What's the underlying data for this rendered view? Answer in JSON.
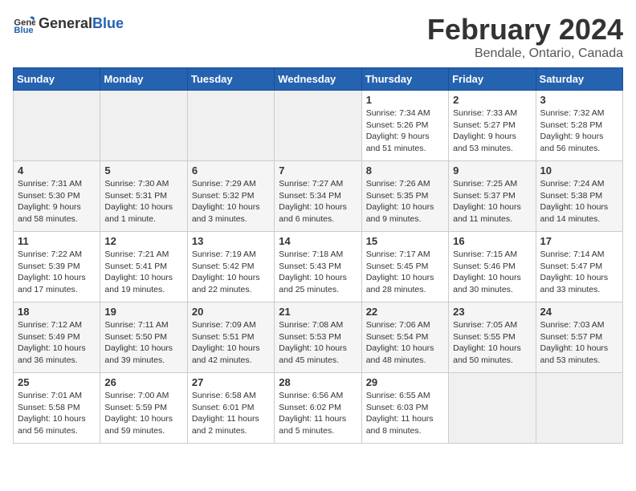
{
  "logo": {
    "text_general": "General",
    "text_blue": "Blue"
  },
  "header": {
    "main_title": "February 2024",
    "subtitle": "Bendale, Ontario, Canada"
  },
  "days_of_week": [
    "Sunday",
    "Monday",
    "Tuesday",
    "Wednesday",
    "Thursday",
    "Friday",
    "Saturday"
  ],
  "weeks": [
    {
      "days": [
        {
          "num": "",
          "info": ""
        },
        {
          "num": "",
          "info": ""
        },
        {
          "num": "",
          "info": ""
        },
        {
          "num": "",
          "info": ""
        },
        {
          "num": "1",
          "info": "Sunrise: 7:34 AM\nSunset: 5:26 PM\nDaylight: 9 hours\nand 51 minutes."
        },
        {
          "num": "2",
          "info": "Sunrise: 7:33 AM\nSunset: 5:27 PM\nDaylight: 9 hours\nand 53 minutes."
        },
        {
          "num": "3",
          "info": "Sunrise: 7:32 AM\nSunset: 5:28 PM\nDaylight: 9 hours\nand 56 minutes."
        }
      ]
    },
    {
      "days": [
        {
          "num": "4",
          "info": "Sunrise: 7:31 AM\nSunset: 5:30 PM\nDaylight: 9 hours\nand 58 minutes."
        },
        {
          "num": "5",
          "info": "Sunrise: 7:30 AM\nSunset: 5:31 PM\nDaylight: 10 hours\nand 1 minute."
        },
        {
          "num": "6",
          "info": "Sunrise: 7:29 AM\nSunset: 5:32 PM\nDaylight: 10 hours\nand 3 minutes."
        },
        {
          "num": "7",
          "info": "Sunrise: 7:27 AM\nSunset: 5:34 PM\nDaylight: 10 hours\nand 6 minutes."
        },
        {
          "num": "8",
          "info": "Sunrise: 7:26 AM\nSunset: 5:35 PM\nDaylight: 10 hours\nand 9 minutes."
        },
        {
          "num": "9",
          "info": "Sunrise: 7:25 AM\nSunset: 5:37 PM\nDaylight: 10 hours\nand 11 minutes."
        },
        {
          "num": "10",
          "info": "Sunrise: 7:24 AM\nSunset: 5:38 PM\nDaylight: 10 hours\nand 14 minutes."
        }
      ]
    },
    {
      "days": [
        {
          "num": "11",
          "info": "Sunrise: 7:22 AM\nSunset: 5:39 PM\nDaylight: 10 hours\nand 17 minutes."
        },
        {
          "num": "12",
          "info": "Sunrise: 7:21 AM\nSunset: 5:41 PM\nDaylight: 10 hours\nand 19 minutes."
        },
        {
          "num": "13",
          "info": "Sunrise: 7:19 AM\nSunset: 5:42 PM\nDaylight: 10 hours\nand 22 minutes."
        },
        {
          "num": "14",
          "info": "Sunrise: 7:18 AM\nSunset: 5:43 PM\nDaylight: 10 hours\nand 25 minutes."
        },
        {
          "num": "15",
          "info": "Sunrise: 7:17 AM\nSunset: 5:45 PM\nDaylight: 10 hours\nand 28 minutes."
        },
        {
          "num": "16",
          "info": "Sunrise: 7:15 AM\nSunset: 5:46 PM\nDaylight: 10 hours\nand 30 minutes."
        },
        {
          "num": "17",
          "info": "Sunrise: 7:14 AM\nSunset: 5:47 PM\nDaylight: 10 hours\nand 33 minutes."
        }
      ]
    },
    {
      "days": [
        {
          "num": "18",
          "info": "Sunrise: 7:12 AM\nSunset: 5:49 PM\nDaylight: 10 hours\nand 36 minutes."
        },
        {
          "num": "19",
          "info": "Sunrise: 7:11 AM\nSunset: 5:50 PM\nDaylight: 10 hours\nand 39 minutes."
        },
        {
          "num": "20",
          "info": "Sunrise: 7:09 AM\nSunset: 5:51 PM\nDaylight: 10 hours\nand 42 minutes."
        },
        {
          "num": "21",
          "info": "Sunrise: 7:08 AM\nSunset: 5:53 PM\nDaylight: 10 hours\nand 45 minutes."
        },
        {
          "num": "22",
          "info": "Sunrise: 7:06 AM\nSunset: 5:54 PM\nDaylight: 10 hours\nand 48 minutes."
        },
        {
          "num": "23",
          "info": "Sunrise: 7:05 AM\nSunset: 5:55 PM\nDaylight: 10 hours\nand 50 minutes."
        },
        {
          "num": "24",
          "info": "Sunrise: 7:03 AM\nSunset: 5:57 PM\nDaylight: 10 hours\nand 53 minutes."
        }
      ]
    },
    {
      "days": [
        {
          "num": "25",
          "info": "Sunrise: 7:01 AM\nSunset: 5:58 PM\nDaylight: 10 hours\nand 56 minutes."
        },
        {
          "num": "26",
          "info": "Sunrise: 7:00 AM\nSunset: 5:59 PM\nDaylight: 10 hours\nand 59 minutes."
        },
        {
          "num": "27",
          "info": "Sunrise: 6:58 AM\nSunset: 6:01 PM\nDaylight: 11 hours\nand 2 minutes."
        },
        {
          "num": "28",
          "info": "Sunrise: 6:56 AM\nSunset: 6:02 PM\nDaylight: 11 hours\nand 5 minutes."
        },
        {
          "num": "29",
          "info": "Sunrise: 6:55 AM\nSunset: 6:03 PM\nDaylight: 11 hours\nand 8 minutes."
        },
        {
          "num": "",
          "info": ""
        },
        {
          "num": "",
          "info": ""
        }
      ]
    }
  ]
}
